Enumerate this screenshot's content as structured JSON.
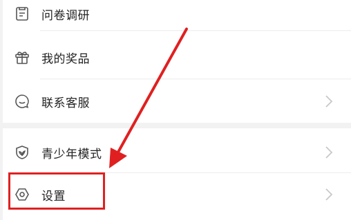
{
  "menu": {
    "items": [
      {
        "label": "问卷调研",
        "icon": "survey-icon",
        "has_chevron": false
      },
      {
        "label": "我的奖品",
        "icon": "gift-icon",
        "has_chevron": false
      },
      {
        "label": "联系客服",
        "icon": "customer-service-icon",
        "has_chevron": true
      },
      {
        "label": "青少年模式",
        "icon": "youth-mode-icon",
        "has_chevron": true
      },
      {
        "label": "设置",
        "icon": "settings-icon",
        "has_chevron": true
      }
    ]
  },
  "annotation": {
    "highlight_color": "#e02020",
    "target": "设置"
  },
  "colors": {
    "background": "#f2f2f2",
    "card": "#ffffff",
    "text": "#222222",
    "icon": "#555555",
    "chevron": "#c8c8c8"
  }
}
